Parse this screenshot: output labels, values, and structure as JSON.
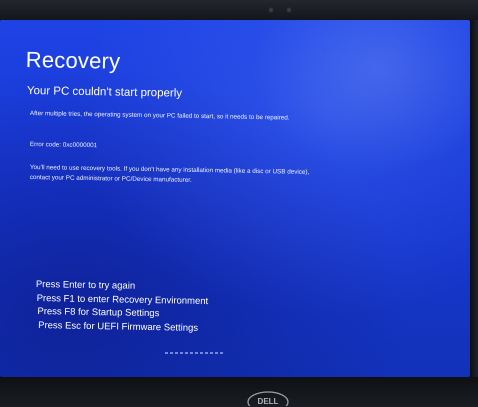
{
  "recovery_screen": {
    "title": "Recovery",
    "subtitle": "Your PC couldn't start properly",
    "message": "After multiple tries, the operating system on your PC failed to start, so it needs to be repaired.",
    "error_code": "Error code: 0xc0000001",
    "instructions": "You'll need to use recovery tools. If you don't have any installation media (like a disc or USB device), contact your PC administrator or PC/Device manufacturer.",
    "options": [
      {
        "label": "Press Enter to try again"
      },
      {
        "label": "Press F1 to enter Recovery Environment"
      },
      {
        "label": "Press F8 for Startup Settings"
      },
      {
        "label": "Press Esc for UEFI Firmware Settings"
      }
    ]
  },
  "device": {
    "brand_logo": "DELL"
  },
  "colors": {
    "screen_blue": "#1e43e4",
    "text": "#ffffff"
  }
}
